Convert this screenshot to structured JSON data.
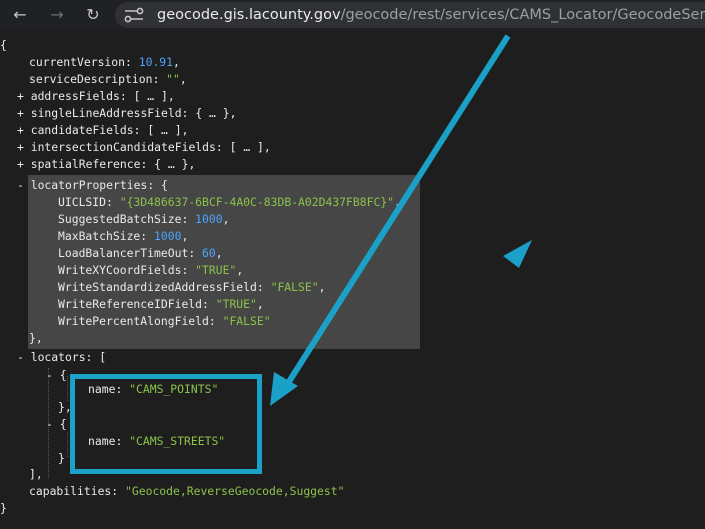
{
  "browser": {
    "back_icon": "back-arrow-icon",
    "forward_icon": "forward-arrow-icon",
    "reload_icon": "reload-icon",
    "site_info_icon": "site-info-icon",
    "back_glyph": "←",
    "forward_glyph": "→",
    "reload_glyph": "↻",
    "url_host": "geocode.gis.lacounty.gov",
    "url_path": "/geocode/rest/services/CAMS_Locator/GeocodeServer?f=json"
  },
  "json": {
    "open_brace": "{",
    "close_brace": "}",
    "currentVersion": {
      "key": "currentVersion",
      "value": "10.91"
    },
    "serviceDescription": {
      "key": "serviceDescription",
      "value": "\"\""
    },
    "collapsed": [
      {
        "key": "addressFields",
        "summary": "[ … ],"
      },
      {
        "key": "singleLineAddressField",
        "summary": "{ … },"
      },
      {
        "key": "candidateFields",
        "summary": "[ … ],"
      },
      {
        "key": "intersectionCandidateFields",
        "summary": "[ … ],"
      },
      {
        "key": "spatialReference",
        "summary": "{ … },"
      }
    ],
    "locatorProperties": {
      "key": "locatorProperties",
      "entries": [
        {
          "key": "UICLSID",
          "value": "\"{3D486637-6BCF-4A0C-83DB-A02D437FB8FC}\"",
          "type": "str"
        },
        {
          "key": "SuggestedBatchSize",
          "value": "1000",
          "type": "num"
        },
        {
          "key": "MaxBatchSize",
          "value": "1000",
          "type": "num"
        },
        {
          "key": "LoadBalancerTimeOut",
          "value": "60",
          "type": "num"
        },
        {
          "key": "WriteXYCoordFields",
          "value": "\"TRUE\"",
          "type": "str"
        },
        {
          "key": "WriteStandardizedAddressField",
          "value": "\"FALSE\"",
          "type": "str"
        },
        {
          "key": "WriteReferenceIDField",
          "value": "\"TRUE\"",
          "type": "str"
        },
        {
          "key": "WritePercentAlongField",
          "value": "\"FALSE\"",
          "type": "str"
        }
      ]
    },
    "locators": {
      "key": "locators",
      "items": [
        {
          "name_key": "name",
          "name_value": "\"CAMS_POINTS\""
        },
        {
          "name_key": "name",
          "name_value": "\"CAMS_STREETS\""
        }
      ]
    },
    "capabilities": {
      "key": "capabilities",
      "value": "\"Geocode,ReverseGeocode,Suggest\""
    }
  },
  "colors": {
    "annotation": "#1ba0c8",
    "number": "#4da3ff",
    "string": "#8bc34a",
    "highlight": "#464646"
  }
}
